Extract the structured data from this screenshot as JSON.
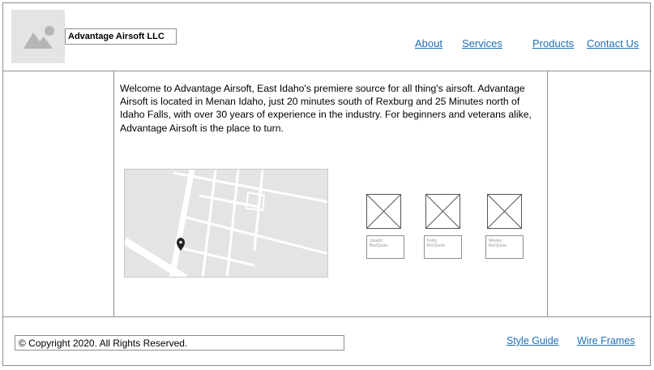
{
  "header": {
    "company_name": "Advantage Airsoft LLC",
    "logo_icon": "image-placeholder-icon",
    "nav": {
      "about": "About",
      "services": "Services",
      "products": "Products",
      "contact": "Contact Us"
    }
  },
  "main": {
    "welcome_text": "Welcome to Advantage Airsoft, East Idaho's premiere source for all thing's airsoft. Advantage Airsoft is located in Menan Idaho, just 20 minutes south of Rexburg and 25 Minutes north of Idaho Falls, with over 30 years of experience in the industry. For beginners and veterans alike, Advantage Airsoft is the place to turn.",
    "map_icon": "map-pin-icon",
    "people": [
      {
        "name": "Joseph",
        "caption": "Bio/Quote"
      },
      {
        "name": "Kolby",
        "caption": "Bio/Quote"
      },
      {
        "name": "Wesley",
        "caption": "Bio/Quote"
      }
    ]
  },
  "footer": {
    "copyright": "© Copyright 2020. All Rights Reserved.",
    "style_guide": "Style Guide",
    "wire_frames": "Wire Frames"
  }
}
